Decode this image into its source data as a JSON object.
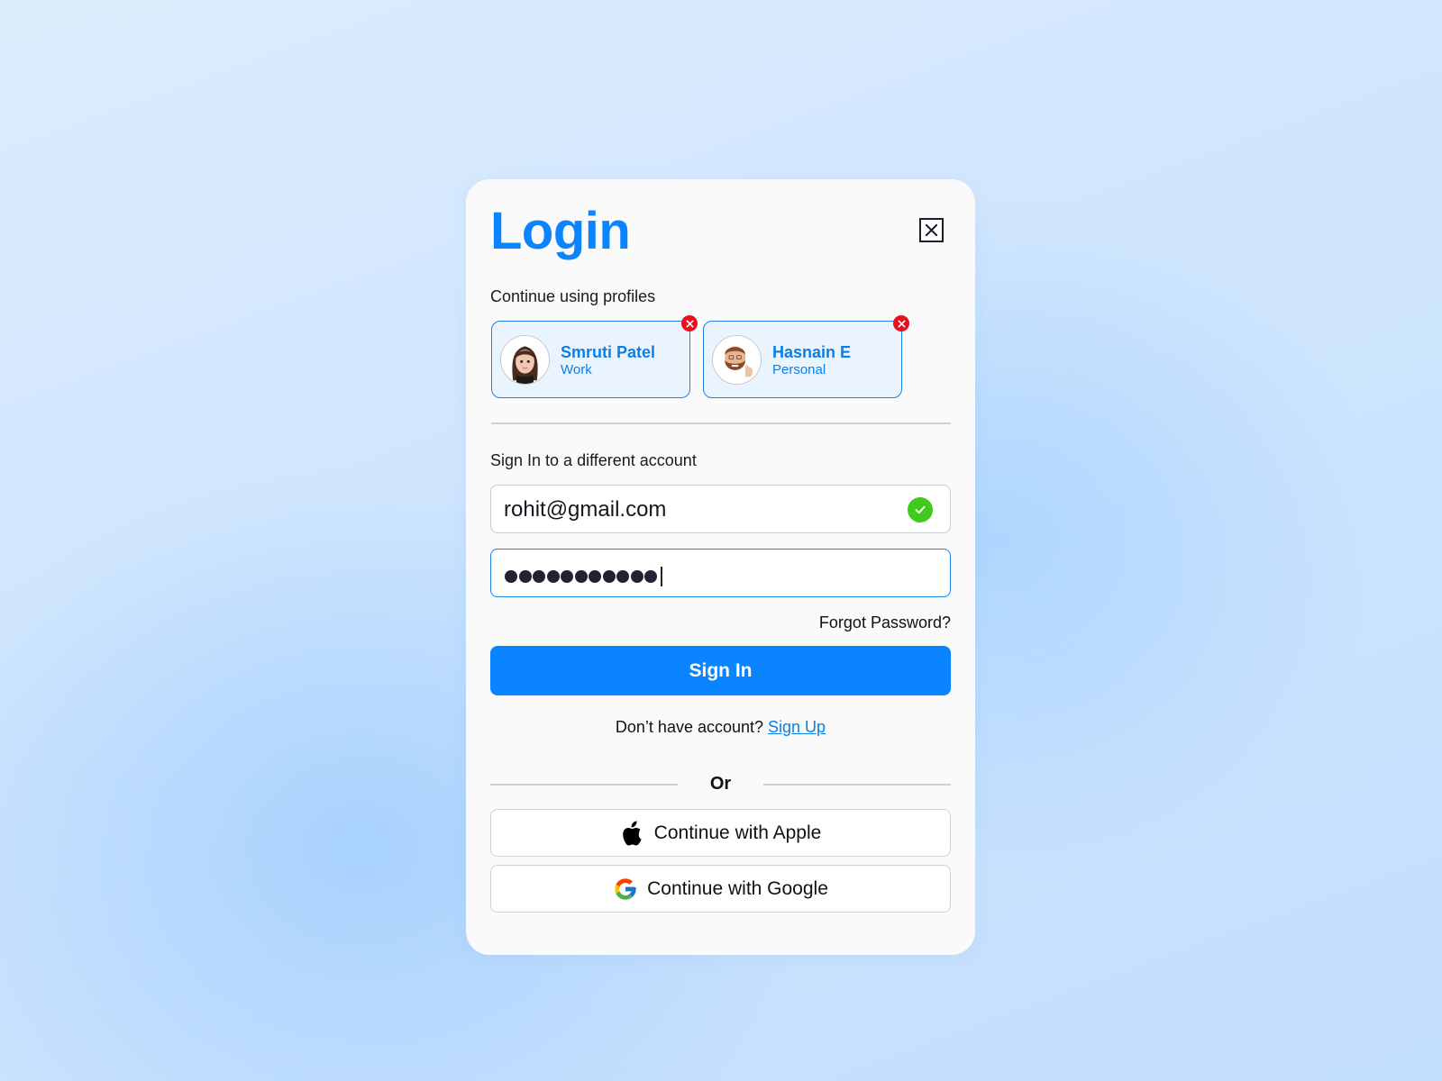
{
  "dialog": {
    "title": "Login",
    "close_icon": "close-box-icon"
  },
  "profiles": {
    "label": "Continue using profiles",
    "items": [
      {
        "name": "Smruti Patel",
        "tag": "Work",
        "avatar": "memoji-woman-avatar",
        "remove_icon": "remove-x-icon"
      },
      {
        "name": "Hasnain E",
        "tag": "Personal",
        "avatar": "memoji-man-thumbs-up-avatar",
        "remove_icon": "remove-x-icon"
      }
    ]
  },
  "signin": {
    "label": "Sign In to a different account",
    "email_value": "rohit@gmail.com",
    "email_valid_icon": "check-circle-icon",
    "password_length": 11,
    "forgot_password": "Forgot Password?",
    "submit_label": "Sign In",
    "no_account_text": "Don’t have account?",
    "signup_link": "Sign Up"
  },
  "alt": {
    "separator": "Or",
    "apple_label": "Continue with Apple",
    "google_label": "Continue with Google"
  },
  "colors": {
    "accent": "#0a84ff",
    "success": "#3fcb1c",
    "danger": "#e8101e",
    "profile_bg": "#eaf4fe"
  }
}
